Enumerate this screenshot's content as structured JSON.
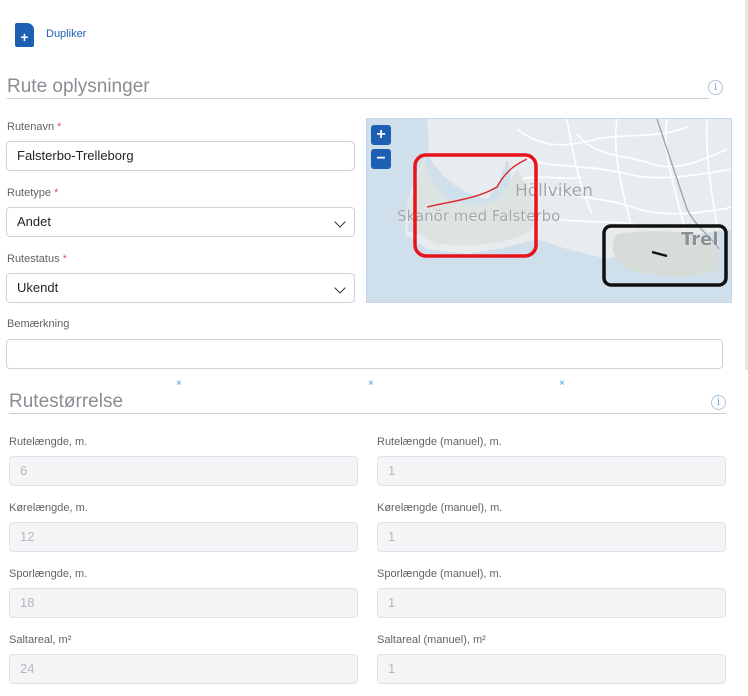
{
  "toolbar": {
    "duplicate_label": "Dupliker",
    "duplicate_icon": "file-plus-icon"
  },
  "route_info": {
    "title": "Rute oplysninger",
    "route_name": {
      "label": "Rutenavn",
      "required_mark": "*",
      "value": "Falsterbo-Trelleborg"
    },
    "route_type": {
      "label": "Rutetype",
      "required_mark": "*",
      "value": "Andet"
    },
    "route_status": {
      "label": "Rutestatus",
      "required_mark": "*",
      "value": "Ukendt"
    },
    "remark": {
      "label": "Bemærkning",
      "value": ""
    },
    "map": {
      "zoom_in": "+",
      "zoom_out": "−",
      "place_labels": [
        "Höllviken",
        "Skanör med Falsterbo",
        "Trel"
      ]
    }
  },
  "route_size": {
    "title": "Rutestørrelse",
    "x_marks": [
      "×",
      "×",
      "×"
    ],
    "fields": [
      {
        "label": "Rutelængde, m.",
        "value": "6"
      },
      {
        "label": "Rutelængde (manuel), m.",
        "value": "1"
      },
      {
        "label": "Kørelængde, m.",
        "value": "12"
      },
      {
        "label": "Kørelængde (manuel), m.",
        "value": "1"
      },
      {
        "label": "Sporlængde, m.",
        "value": "18"
      },
      {
        "label": "Sporlængde (manuel), m.",
        "value": "1"
      },
      {
        "label": "Saltareal, m²",
        "value": "24"
      },
      {
        "label": "Saltareal (manuel), m²",
        "value": "1"
      }
    ]
  },
  "colors": {
    "accent": "#1d5fb3",
    "highlight_red": "#e8141c",
    "highlight_black": "#111111",
    "route_line": "#d9262b"
  }
}
